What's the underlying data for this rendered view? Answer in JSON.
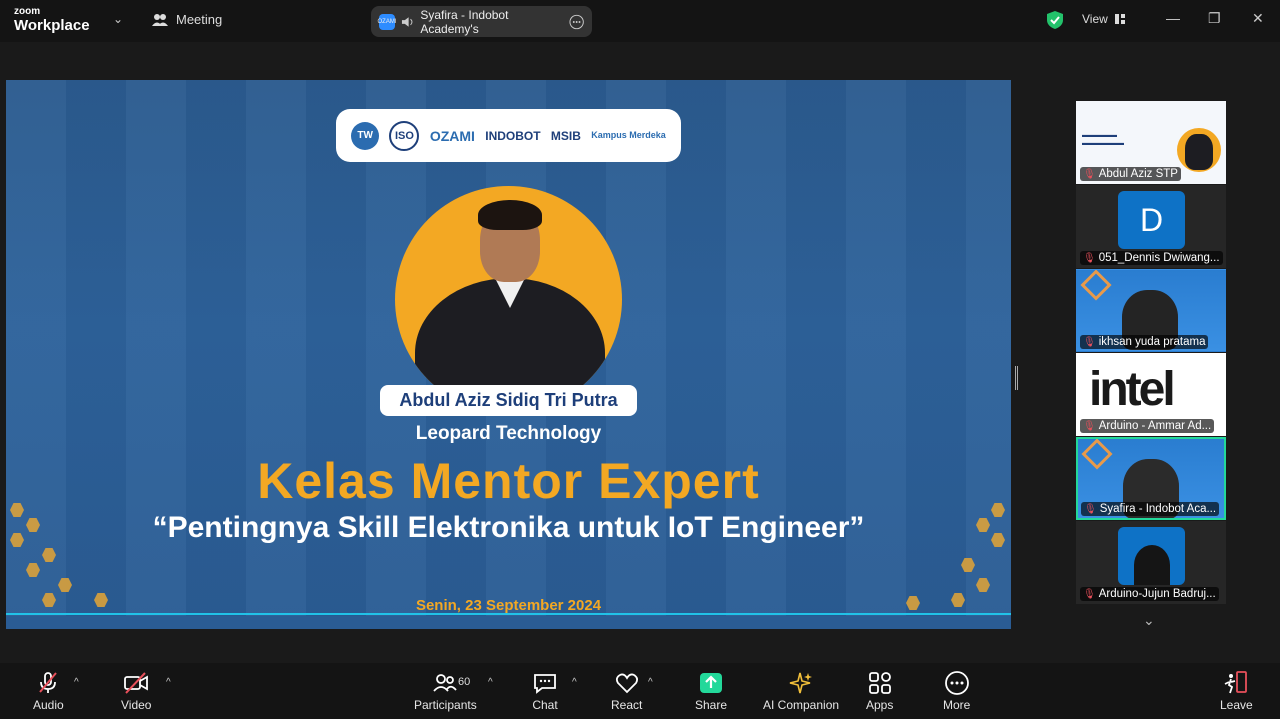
{
  "topbar": {
    "brand_small": "zoom",
    "brand_big": "Workplace",
    "meeting_label": "Meeting",
    "share_label": "Syafira - Indobot Academy's",
    "share_logo": "OZAMI",
    "view_label": "View"
  },
  "slide": {
    "logos": [
      "ISO",
      "OZAMI",
      "INDOBOT",
      "MSIB",
      "Kampus Merdeka"
    ],
    "speaker_name": "Abdul Aziz Sidiq Tri Putra",
    "company": "Leopard Technology",
    "title": "Kelas Mentor Expert",
    "subtitle": "“Pentingnya Skill Elektronika untuk IoT Engineer”",
    "date": "Senin, 23 September 2024"
  },
  "gallery": {
    "tiles": [
      {
        "name": "Abdul Aziz STP"
      },
      {
        "name": "051_Dennis Dwiwang...",
        "initial": "D"
      },
      {
        "name": "ikhsan yuda pratama"
      },
      {
        "name": "Arduino - Ammar Ad...",
        "logo_text": "intel"
      },
      {
        "name": "Syafira - Indobot Aca..."
      },
      {
        "name": "Arduino-Jujun Badruj..."
      }
    ]
  },
  "toolbar": {
    "audio": "Audio",
    "video": "Video",
    "participants": "Participants",
    "participant_count": "60",
    "chat": "Chat",
    "react": "React",
    "share": "Share",
    "ai": "AI Companion",
    "apps": "Apps",
    "more": "More",
    "leave": "Leave"
  },
  "colors": {
    "accent_orange": "#f3a823",
    "slide_blue": "#2d629b",
    "share_green": "#23d89a",
    "mute_red": "#e8505b"
  }
}
